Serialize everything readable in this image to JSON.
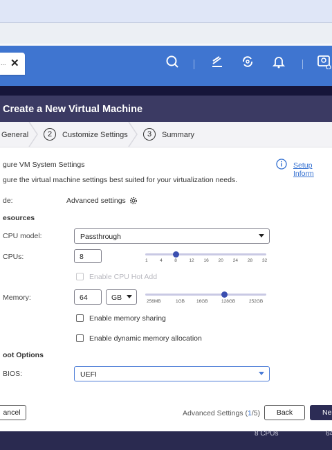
{
  "header": {
    "tab_text": "... ",
    "tab_close": "✕"
  },
  "dialog": {
    "title": "Create a New Virtual Machine",
    "steps": [
      {
        "num": "",
        "label": "General"
      },
      {
        "num": "2",
        "label": "Customize Settings"
      },
      {
        "num": "3",
        "label": "Summary"
      }
    ],
    "section_title": "gure VM System Settings",
    "setup_link": "Setup Inform",
    "description": "gure the virtual machine settings best suited for your virtualization needs.",
    "mode_label": "de:",
    "mode_value": "Advanced settings",
    "resources_label": "esources",
    "cpu_model_label": "CPU model:",
    "cpu_model_value": "Passthrough",
    "cpus_label": "CPUs:",
    "cpus_value": "8",
    "cpus_slider": {
      "min": 1,
      "max": 32,
      "value": 8,
      "ticks": [
        "1",
        "4",
        "8",
        "12",
        "16",
        "20",
        "24",
        "28",
        "32"
      ]
    },
    "cpu_hot_add_label": "Enable CPU Hot Add",
    "memory_label": "Memory:",
    "memory_value": "64",
    "memory_unit": "GB",
    "memory_slider": {
      "ticks": [
        "256MB",
        "1GB",
        "16GB",
        "128GB",
        "252GB"
      ],
      "value_label": "128GB"
    },
    "memory_sharing_label": "Enable memory sharing",
    "dynamic_memory_label": "Enable dynamic memory allocation",
    "boot_options_label": "oot Options",
    "bios_label": "BIOS:",
    "bios_value": "UEFI",
    "footer": {
      "cancel": "ancel",
      "advanced_settings_prefix": "Advanced Settings (",
      "advanced_settings_page": "1",
      "advanced_settings_suffix": "/5)",
      "back": "Back",
      "next": "Ne"
    }
  },
  "background": {
    "bottom_left": "8 CPUs",
    "bottom_right": "64"
  }
}
